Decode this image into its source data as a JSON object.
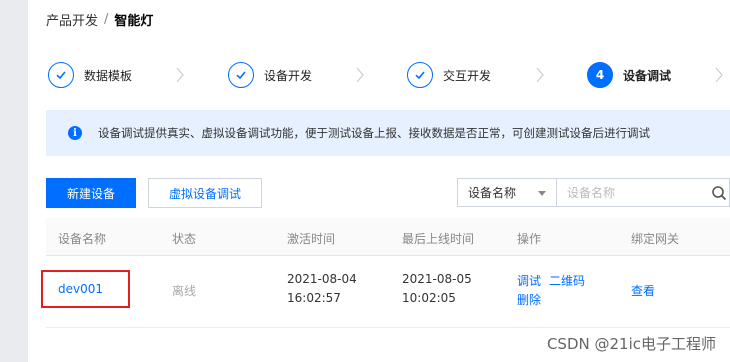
{
  "breadcrumb": {
    "parent": "产品开发",
    "separator": "/",
    "current": "智能灯"
  },
  "steps": [
    {
      "label": "数据模板",
      "state": "done"
    },
    {
      "label": "设备开发",
      "state": "done"
    },
    {
      "label": "交互开发",
      "state": "done"
    },
    {
      "label": "设备调试",
      "state": "active",
      "number": "4"
    }
  ],
  "notice": {
    "icon": "info-icon",
    "text": "设备调试提供真实、虚拟设备调试功能，便于测试设备上报、接收数据是否正常，可创建测试设备后进行调试"
  },
  "toolbar": {
    "create_label": "新建设备",
    "virtual_label": "虚拟设备调试"
  },
  "filter": {
    "selected": "设备名称",
    "placeholder": "设备名称"
  },
  "table": {
    "headers": [
      "设备名称",
      "状态",
      "激活时间",
      "最后上线时间",
      "操作",
      "绑定网关"
    ],
    "rows": [
      {
        "name": "dev001",
        "status": "离线",
        "activated_date": "2021-08-04",
        "activated_time": "16:02:57",
        "last_online_date": "2021-08-05",
        "last_online_time": "10:02:05",
        "action_debug": "调试",
        "action_qrcode": "二维码",
        "action_delete": "删除",
        "gateway": "查看"
      }
    ]
  },
  "watermark": "CSDN @21ic电子工程师",
  "colors": {
    "primary": "#006eff",
    "notice_bg": "#e6f0ff",
    "highlight": "#e02020"
  }
}
